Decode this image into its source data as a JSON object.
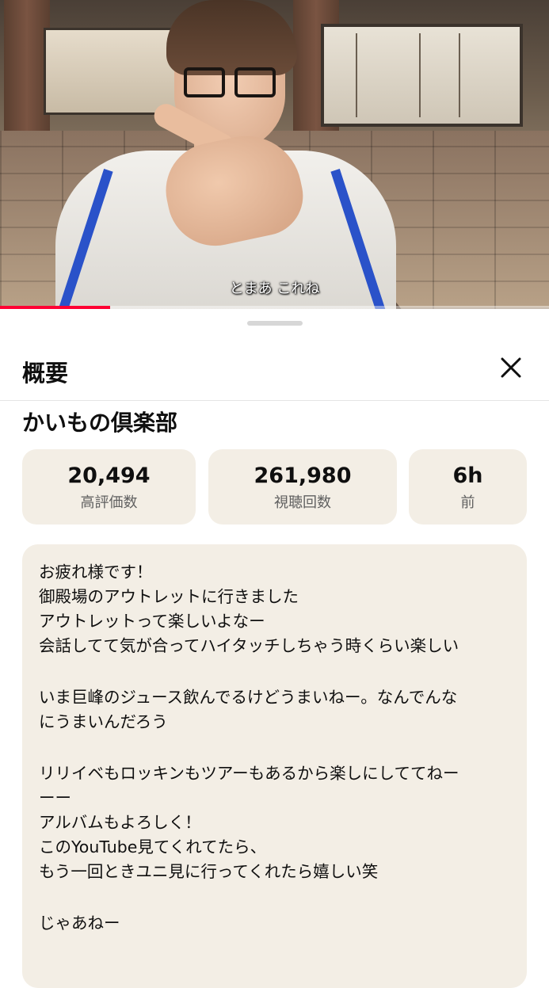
{
  "video": {
    "subtitle": "とまあ これね",
    "progress_fraction": 0.2
  },
  "panel": {
    "title": "概要",
    "close_icon": "close-icon",
    "channel_name": "かいもの倶楽部"
  },
  "stats": [
    {
      "value": "20,494",
      "label": "高評価数"
    },
    {
      "value": "261,980",
      "label": "視聴回数"
    },
    {
      "value": "6h",
      "label": "前"
    }
  ],
  "description": {
    "lines": [
      "お疲れ様です！",
      "御殿場のアウトレットに行きました",
      "アウトレットって楽しいよなー",
      "会話してて気が合ってハイタッチしちゃう時くらい楽しい",
      "",
      "いま巨峰のジュース飲んでるけどうまいねー。なんでんな",
      "にうまいんだろう",
      "",
      "リリイベもロッキンもツアーもあるから楽しにしててねー",
      "ーー",
      "アルバムもよろしく！",
      "このYouTube見てくれてたら、",
      "もう一回ときユニ見に行ってくれたら嬉しい笑",
      "",
      "じゃあねー"
    ]
  },
  "colors": {
    "accent": "#ff0033",
    "card_bg": "#f3eee5"
  }
}
